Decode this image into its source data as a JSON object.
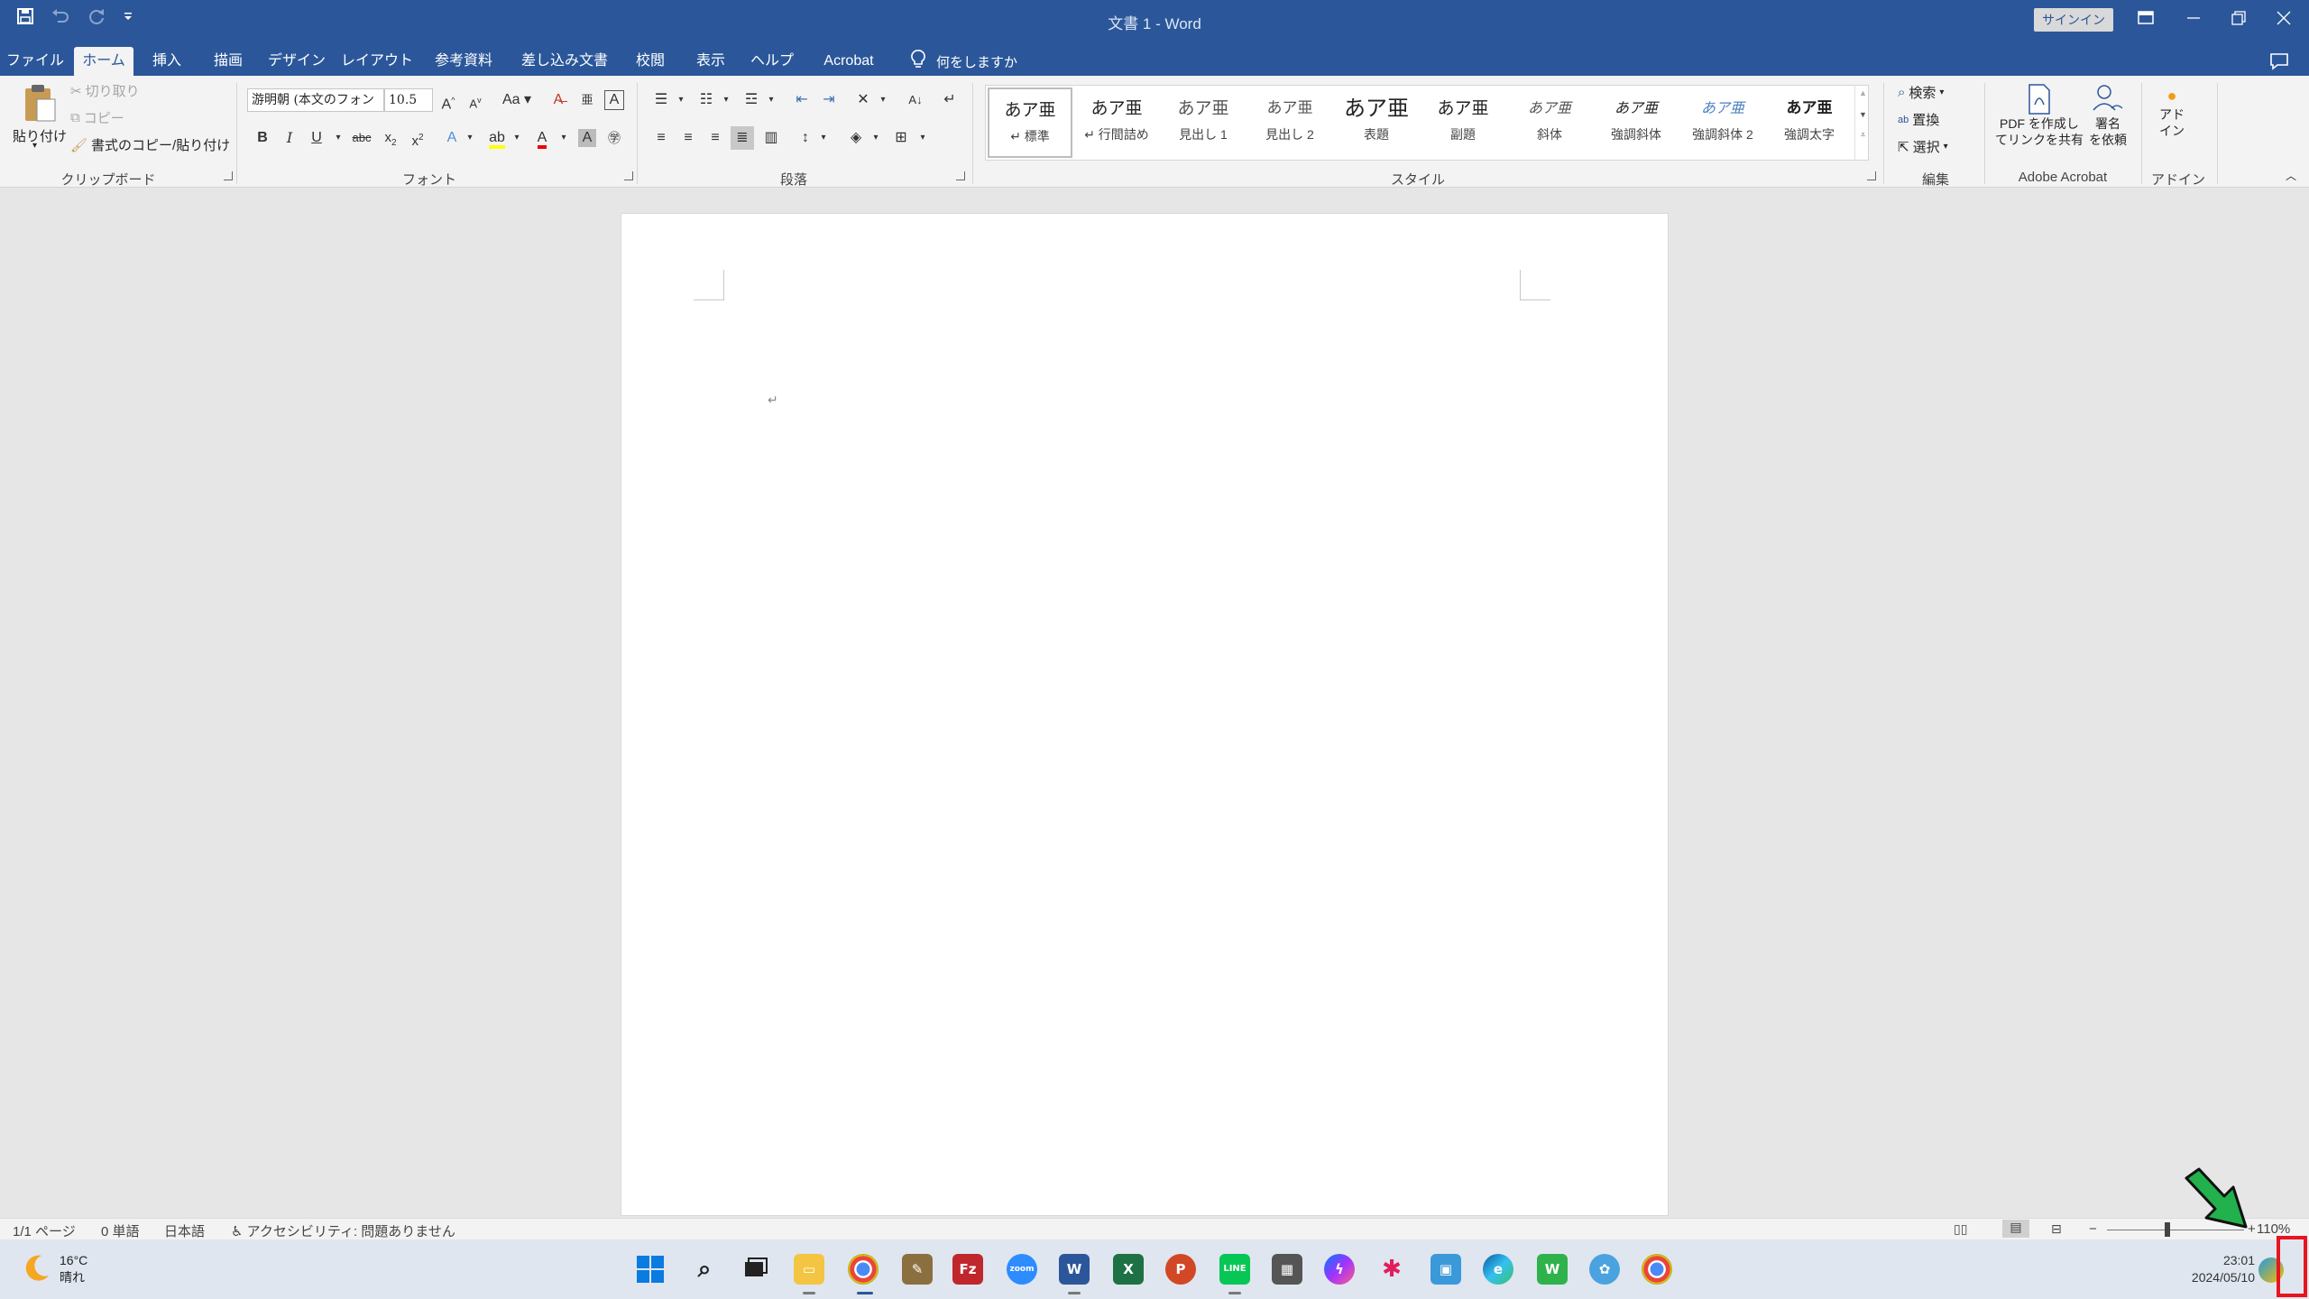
{
  "window": {
    "title": "文書 1  -  Word",
    "signin": "サインイン"
  },
  "tabs": [
    "ファイル",
    "ホーム",
    "挿入",
    "描画",
    "デザイン",
    "レイアウト",
    "参考資料",
    "差し込み文書",
    "校閲",
    "表示",
    "ヘルプ",
    "Acrobat"
  ],
  "active_tab": "ホーム",
  "tell_me": "何をしますか",
  "clipboard": {
    "paste": "貼り付け",
    "cut": "切り取り",
    "copy": "コピー",
    "format_painter": "書式のコピー/貼り付け",
    "label": "クリップボード"
  },
  "font": {
    "name": "游明朝 (本文のフォン",
    "size": "10.5",
    "case": "Aa",
    "bold": "B",
    "italic": "I",
    "underline": "U",
    "strike": "abc",
    "label": "フォント"
  },
  "paragraph": {
    "label": "段落"
  },
  "styles": {
    "label": "スタイル",
    "items": [
      {
        "preview": "あア亜",
        "name": "↵ 標準"
      },
      {
        "preview": "あア亜",
        "name": "↵ 行間詰め"
      },
      {
        "preview": "あア亜",
        "name": "見出し 1"
      },
      {
        "preview": "あア亜",
        "name": "見出し 2"
      },
      {
        "preview": "あア亜",
        "name": "表題"
      },
      {
        "preview": "あア亜",
        "name": "副題"
      },
      {
        "preview": "あア亜",
        "name": "斜体"
      },
      {
        "preview": "あア亜",
        "name": "強調斜体"
      },
      {
        "preview": "あア亜",
        "name": "強調斜体 2"
      },
      {
        "preview": "あア亜",
        "name": "強調太字"
      }
    ]
  },
  "editing": {
    "find": "検索",
    "replace": "置換",
    "select": "選択",
    "label": "編集"
  },
  "acrobat": {
    "create_pdf_1": "PDF を作成し",
    "create_pdf_2": "てリンクを共有",
    "sign_1": "署名",
    "sign_2": "を依頼",
    "label": "Adobe Acrobat"
  },
  "addin": {
    "btn_1": "アド",
    "btn_2": "イン",
    "label": "アドイン"
  },
  "document": {
    "paragraph_mark": "↵"
  },
  "statusbar": {
    "page": "1/1 ページ",
    "words": "0 単語",
    "language": "日本語",
    "accessibility": "アクセシビリティ: 問題ありません",
    "zoom": "110%"
  },
  "taskbar": {
    "temp": "16°C",
    "weather": "晴れ",
    "time": "23:01",
    "date": "2024/05/10",
    "apps": [
      "start-icon",
      "search-icon",
      "task-view-icon",
      "file-explorer-icon",
      "chrome-icon",
      "notepad-icon",
      "filezilla-icon",
      "zoom-icon",
      "word-icon",
      "excel-icon",
      "powerpoint-icon",
      "line-icon",
      "calculator-icon",
      "messenger-icon",
      "slack-icon",
      "photos-icon",
      "edge-icon",
      "w-icon",
      "app-icon",
      "chrome-2-icon"
    ]
  },
  "colors": {
    "accent": "#2b579a",
    "arrow": "#22b14c",
    "highlight": "#e8141e"
  }
}
